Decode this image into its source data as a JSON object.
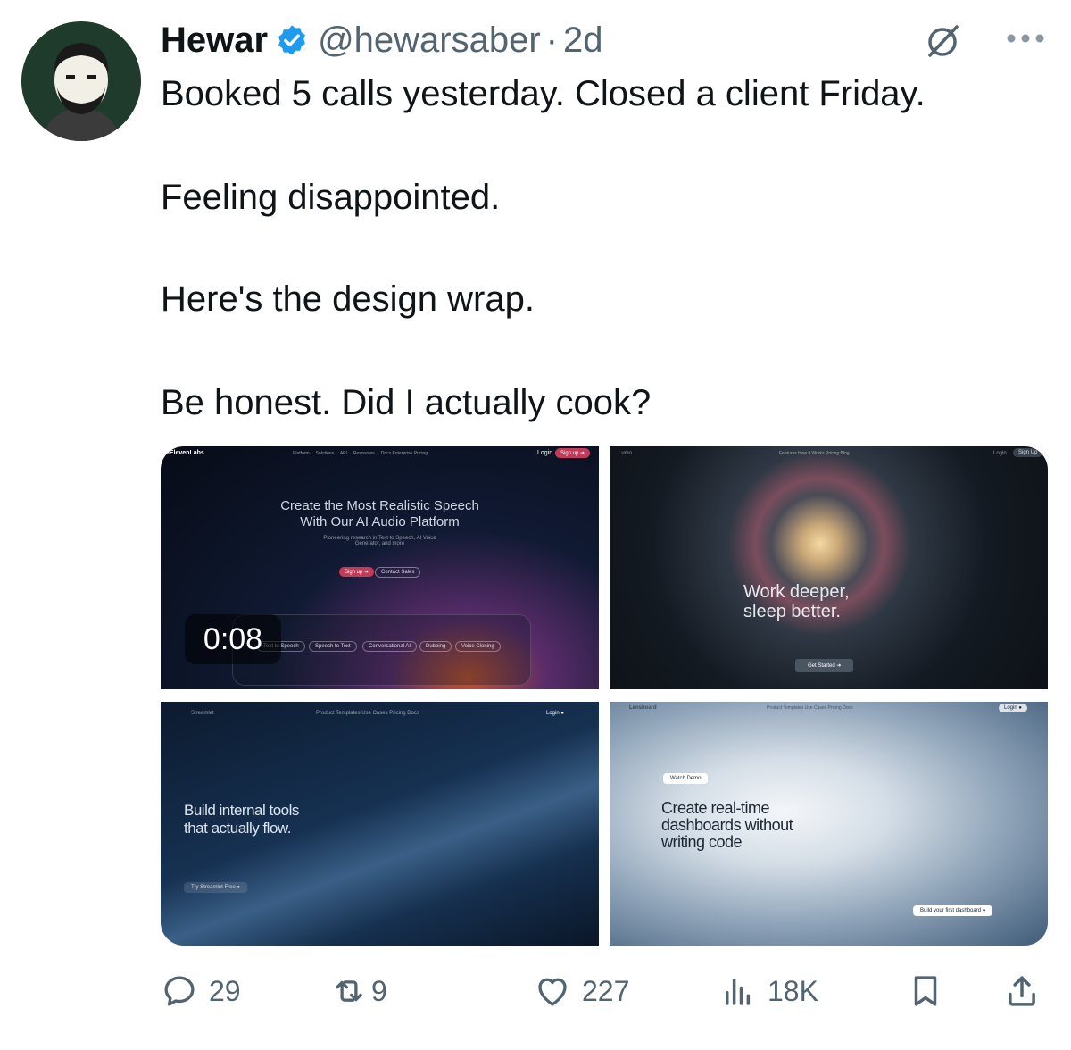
{
  "author": {
    "name": "Hewar",
    "handle": "@hewarsaber",
    "separator": "·",
    "time": "2d"
  },
  "tweet": {
    "lines": [
      "Booked 5 calls yesterday. Closed a client Friday.",
      "Feeling disappointed.",
      "Here's the design wrap.",
      "Be honest. Did I actually cook?"
    ]
  },
  "media": {
    "timer": "0:08",
    "tile1": {
      "logo": "IIElevenLabs",
      "nav": "Platform ⌄   Solutions ⌄   API ⌄   Resources ⌄   Docs   Enterprise   Pricing",
      "login": "Login",
      "signup": "Sign up ➜",
      "headline": "Create the Most Realistic Speech\nWith Our AI Audio Platform",
      "sub": "Pioneering research in Text to Speech, AI Voice\nGenerator, and more",
      "cta1": "Sign up ➜",
      "cta2": "Contact Sales",
      "chips": [
        "Text to Speech",
        "Speech to Text",
        "Conversational AI",
        "Dubbing",
        "Voice Cloning"
      ]
    },
    "tile2": {
      "logo": "Lumo",
      "nav": "Features    How it Works    Pricing    Blog",
      "login": "Login",
      "signup": "Sign Up",
      "headline": "Work deeper,\nsleep better.",
      "cta": "Get Started ➜"
    },
    "tile3": {
      "logo": "Streamlet",
      "nav": "Product    Templates    Use Cases    Pricing    Docs",
      "login": "Login ●",
      "headline": "Build internal tools\nthat actually flow.",
      "cta": "Try Streamlet Free ●"
    },
    "tile4": {
      "logo": "Lensboard",
      "nav": "Product    Templates    Use Cases    Pricing    Docs",
      "login": "Login ●",
      "badge": "Watch Demo",
      "headline": "Create real-time\ndashboards without\nwriting code",
      "cta": "Build your first dashboard ●"
    }
  },
  "actions": {
    "replies": "29",
    "reposts": "9",
    "likes": "227",
    "views": "18K"
  },
  "colors": {
    "text": "#0f1419",
    "secondary": "#536471",
    "verified": "#1d9bf0"
  }
}
